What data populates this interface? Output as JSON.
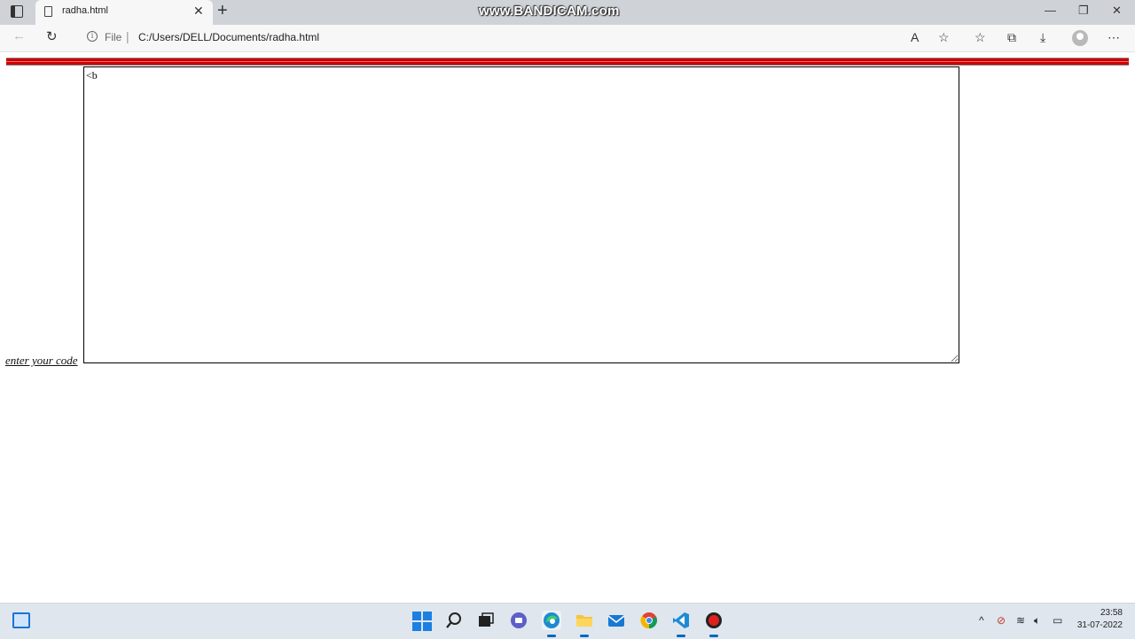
{
  "browser": {
    "tab_title": "radha.html",
    "tab_close": "✕",
    "new_tab": "+",
    "watermark": "www.BANDICAM.com",
    "address": {
      "security_label": "File",
      "url": "C:/Users/DELL/Documents/radha.html"
    },
    "icons": [
      "tab-actions-icon",
      "page-icon",
      "back-icon",
      "reload-icon",
      "info-icon",
      "read-aloud-icon",
      "add-favorite-icon",
      "favorites-icon",
      "collections-icon",
      "downloads-icon",
      "profile-icon",
      "more-icon",
      "minimize-icon",
      "restore-icon",
      "close-icon"
    ]
  },
  "page": {
    "rule_color": "#cc0000",
    "label": "enter your code",
    "textarea_value": "<b"
  },
  "taskbar": {
    "apps": [
      "windows-start",
      "search",
      "task-view",
      "teams-chat",
      "edge",
      "file-explorer",
      "mail",
      "chrome",
      "vscode",
      "bandicam-record"
    ],
    "time": "23:58",
    "date": "31-07-2022"
  }
}
